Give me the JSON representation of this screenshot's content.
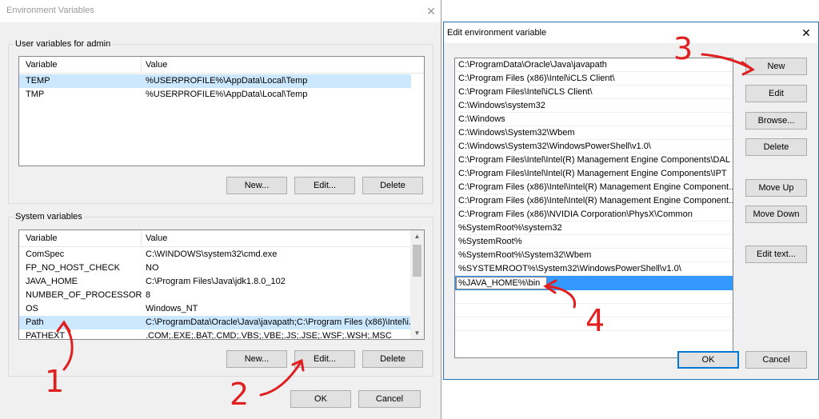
{
  "env_window": {
    "title": "Environment Variables",
    "user_group": {
      "label": "User variables for admin",
      "headers": [
        "Variable",
        "Value"
      ],
      "rows": [
        {
          "variable": "TEMP",
          "value": "%USERPROFILE%\\AppData\\Local\\Temp"
        },
        {
          "variable": "TMP",
          "value": "%USERPROFILE%\\AppData\\Local\\Temp"
        }
      ],
      "new_label": "New...",
      "edit_label": "Edit...",
      "delete_label": "Delete"
    },
    "system_group": {
      "label": "System variables",
      "headers": [
        "Variable",
        "Value"
      ],
      "rows": [
        {
          "variable": "ComSpec",
          "value": "C:\\WINDOWS\\system32\\cmd.exe"
        },
        {
          "variable": "FP_NO_HOST_CHECK",
          "value": "NO"
        },
        {
          "variable": "JAVA_HOME",
          "value": "C:\\Program Files\\Java\\jdk1.8.0_102"
        },
        {
          "variable": "NUMBER_OF_PROCESSORS",
          "value": "8"
        },
        {
          "variable": "OS",
          "value": "Windows_NT"
        },
        {
          "variable": "Path",
          "value": "C:\\ProgramData\\Oracle\\Java\\javapath;C:\\Program Files (x86)\\Intel\\i..."
        },
        {
          "variable": "PATHEXT",
          "value": ".COM;.EXE;.BAT;.CMD;.VBS;.VBE;.JS;.JSE;.WSF;.WSH;.MSC"
        }
      ],
      "new_label": "New...",
      "edit_label": "Edit...",
      "delete_label": "Delete"
    },
    "ok_label": "OK",
    "cancel_label": "Cancel"
  },
  "edit_window": {
    "title": "Edit environment variable",
    "entries": [
      "C:\\ProgramData\\Oracle\\Java\\javapath",
      "C:\\Program Files (x86)\\Intel\\iCLS Client\\",
      "C:\\Program Files\\Intel\\iCLS Client\\",
      "C:\\Windows\\system32",
      "C:\\Windows",
      "C:\\Windows\\System32\\Wbem",
      "C:\\Windows\\System32\\WindowsPowerShell\\v1.0\\",
      "C:\\Program Files\\Intel\\Intel(R) Management Engine Components\\DAL",
      "C:\\Program Files\\Intel\\Intel(R) Management Engine Components\\IPT",
      "C:\\Program Files (x86)\\Intel\\Intel(R) Management Engine Component...",
      "C:\\Program Files (x86)\\Intel\\Intel(R) Management Engine Component...",
      "C:\\Program Files (x86)\\NVIDIA Corporation\\PhysX\\Common",
      "%SystemRoot%\\system32",
      "%SystemRoot%",
      "%SystemRoot%\\System32\\Wbem",
      "%SYSTEMROOT%\\System32\\WindowsPowerShell\\v1.0\\"
    ],
    "editing_value": "%JAVA_HOME%\\bin",
    "buttons": {
      "new": "New",
      "edit": "Edit",
      "browse": "Browse...",
      "delete": "Delete",
      "move_up": "Move Up",
      "move_down": "Move Down",
      "edit_text": "Edit text...",
      "ok": "OK",
      "cancel": "Cancel"
    }
  },
  "annotations": [
    "1",
    "2",
    "3",
    "4"
  ],
  "colors": {
    "annotation_red": "#e02020",
    "selection_blue": "#3399ff",
    "row_highlight": "#cce8ff",
    "accent": "#0078d7"
  },
  "icons": {
    "close": "close-icon",
    "scroll_up": "chevron-up-icon",
    "scroll_down": "chevron-down-icon"
  }
}
